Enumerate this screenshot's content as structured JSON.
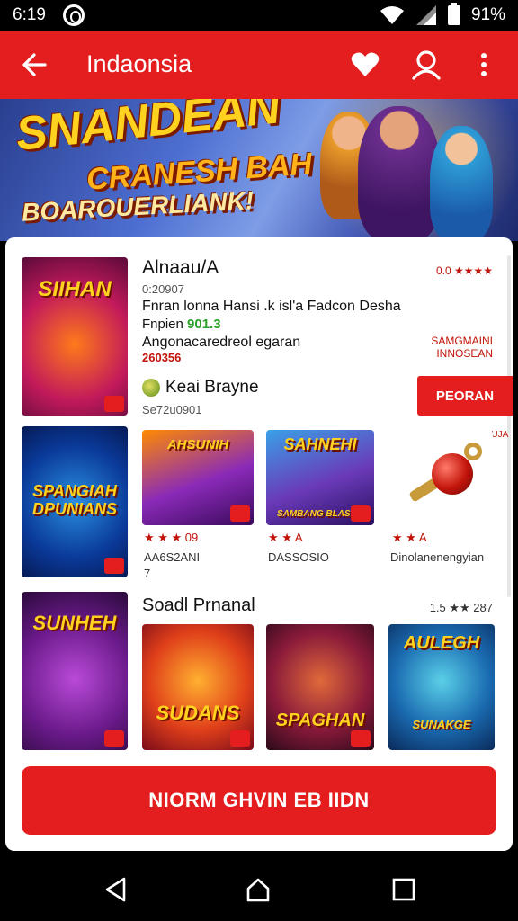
{
  "status_bar": {
    "time": "6:19",
    "battery": "91%"
  },
  "toolbar": {
    "title": "Indaonsia"
  },
  "banner": {
    "line1": "SNANDEAN",
    "line2": "CRANESH BAH",
    "line3": "BOAROUERLIANK!"
  },
  "featured": {
    "thumb_label": "SIIHAN",
    "title": "Alnaau/A",
    "id_text": "0:20907",
    "description": "Fnran lonna Hansi .k isl'a Fadcon Desha",
    "price_label": "Fnpien",
    "price_value": "901.3",
    "arrangement": "Angonacaredreol egaran",
    "rating_text": "260356",
    "top_right_rating": "0.0 ★★★★",
    "side_red_line1": "SAMGMAINI",
    "side_red_line2": "INNOSEAN",
    "developer": "Keai Brayne",
    "developer_sub": "Se72u0901",
    "cta": "PEORAN"
  },
  "row2": {
    "tall_label": "SPANGIAH DPUNIANS",
    "sq1_label": "AHSUNIH",
    "sq2_label": "SAHNEHI",
    "sq2_sublabel": "SAMBANG BLASHB",
    "key_caption": "ENOSBIAISANEANUJA",
    "meta1": "★ ★ ★ 09",
    "meta2": "★ ★ A",
    "meta3": "★ ★ A",
    "caption1": "AA6S2ANI",
    "caption1b": "7",
    "caption2": "DASSOSIO",
    "caption3": "Dinolanenengyian"
  },
  "section": {
    "title": "Soadl Prnanal",
    "meta": "1.5 ★★ 287",
    "tall_label": "SUNHEH",
    "sq3_label": "SUDANS",
    "sq4_label": "SPAGHAN",
    "sq5_label": "AULEGH",
    "sq5_sublabel": "SUNAKGE"
  },
  "big_cta": "NIORM GHVIN EB IIDN",
  "colors": {
    "accent": "#e41e1e",
    "price": "#2aa02a"
  }
}
